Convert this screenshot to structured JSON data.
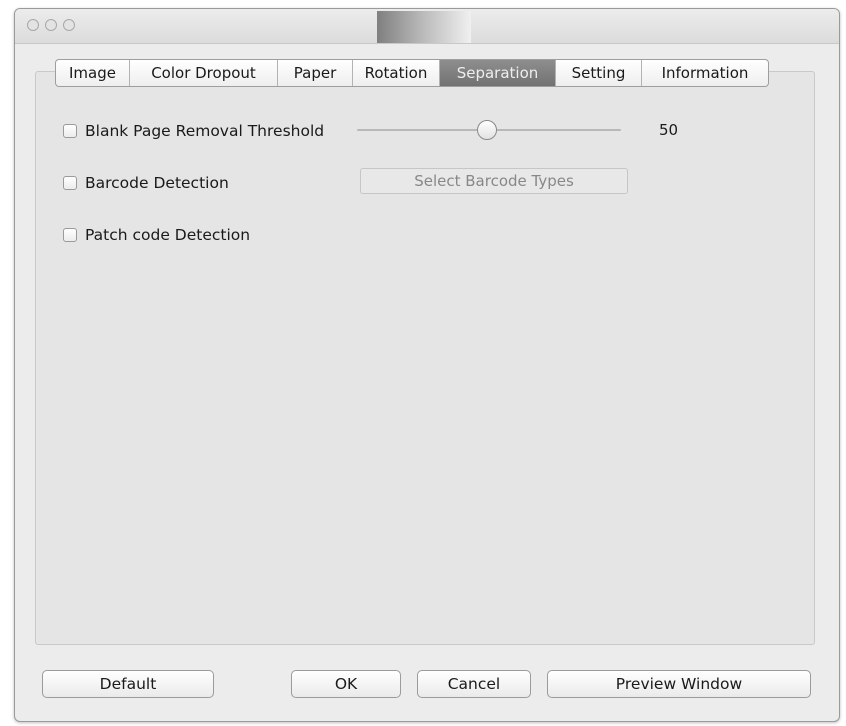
{
  "window": {
    "title_thumbnail": "title-thumbnail"
  },
  "tabs": [
    {
      "label": "Image"
    },
    {
      "label": "Color Dropout"
    },
    {
      "label": "Paper"
    },
    {
      "label": "Rotation"
    },
    {
      "label": "Separation",
      "active": true
    },
    {
      "label": "Setting"
    },
    {
      "label": "Information"
    }
  ],
  "separation": {
    "blank_page": {
      "label": "Blank Page Removal Threshold",
      "checked": false,
      "value": "50",
      "level_fraction": 0.49
    },
    "barcode": {
      "label": "Barcode Detection",
      "checked": false,
      "button_label": "Select Barcode Types"
    },
    "patch_code": {
      "label": "Patch code Detection",
      "checked": false
    }
  },
  "buttons": {
    "default": "Default",
    "ok": "OK",
    "cancel": "Cancel",
    "preview": "Preview Window"
  },
  "colors": {
    "active_tab": "#7f7f7f",
    "window_bg": "#ececec",
    "panel_bg": "#e5e5e5"
  }
}
